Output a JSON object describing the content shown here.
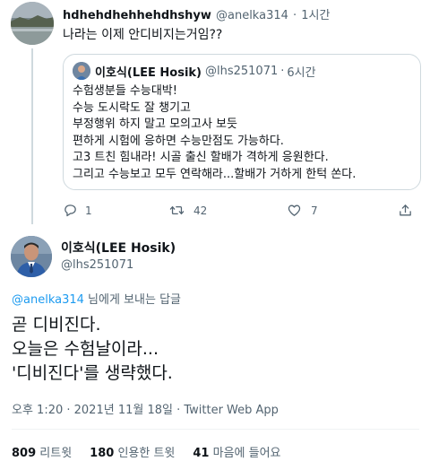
{
  "reply_tweet": {
    "display_name": "hdhehdhehhehdhshyw",
    "handle": "@anelka314",
    "time": "1시간",
    "text": "나라는 이제 안디비지는거임??"
  },
  "quoted_tweet": {
    "display_name": "이호식(LEE Hosik)",
    "handle": "@lhs251071",
    "time": "6시간",
    "lines": [
      "수험생분들 수능대박!",
      "수능 도시락도 잘 챙기고",
      "부정행위 하지 말고 모의고사 보듯",
      "편하게 시험에 응하면 수능만점도 가능하다.",
      "고3 트친 힘내라! 시골 출신 할배가 격하게 응원한다.",
      "그리고 수능보고 모두 연락해라...할배가 거하게 한턱 쏜다."
    ]
  },
  "reply_actions": {
    "reply_count": "1",
    "retweet_count": "42",
    "like_count": "7"
  },
  "main_tweet": {
    "display_name": "이호식(LEE Hosik)",
    "handle": "@lhs251071",
    "reply_to_handle": "@anelka314",
    "reply_to_suffix": "님에게 보내는 답글",
    "lines": [
      "곧 디비진다.",
      "오늘은 수험날이라...",
      "'디비진다'를 생략했다."
    ],
    "meta": "오후 1:20 · 2021년 11월 18일 · Twitter Web App"
  },
  "stats": {
    "retweets_count": "809",
    "retweets_label": "리트윗",
    "quotes_count": "180",
    "quotes_label": "인용한 트윗",
    "likes_count": "41",
    "likes_label": "마음에 들어요"
  },
  "colors": {
    "text": "#0f1419",
    "muted": "#536471",
    "link": "#1d9bf0",
    "border": "#cfd9de"
  },
  "icons": [
    "reply-icon",
    "retweet-icon",
    "like-icon",
    "share-icon"
  ]
}
